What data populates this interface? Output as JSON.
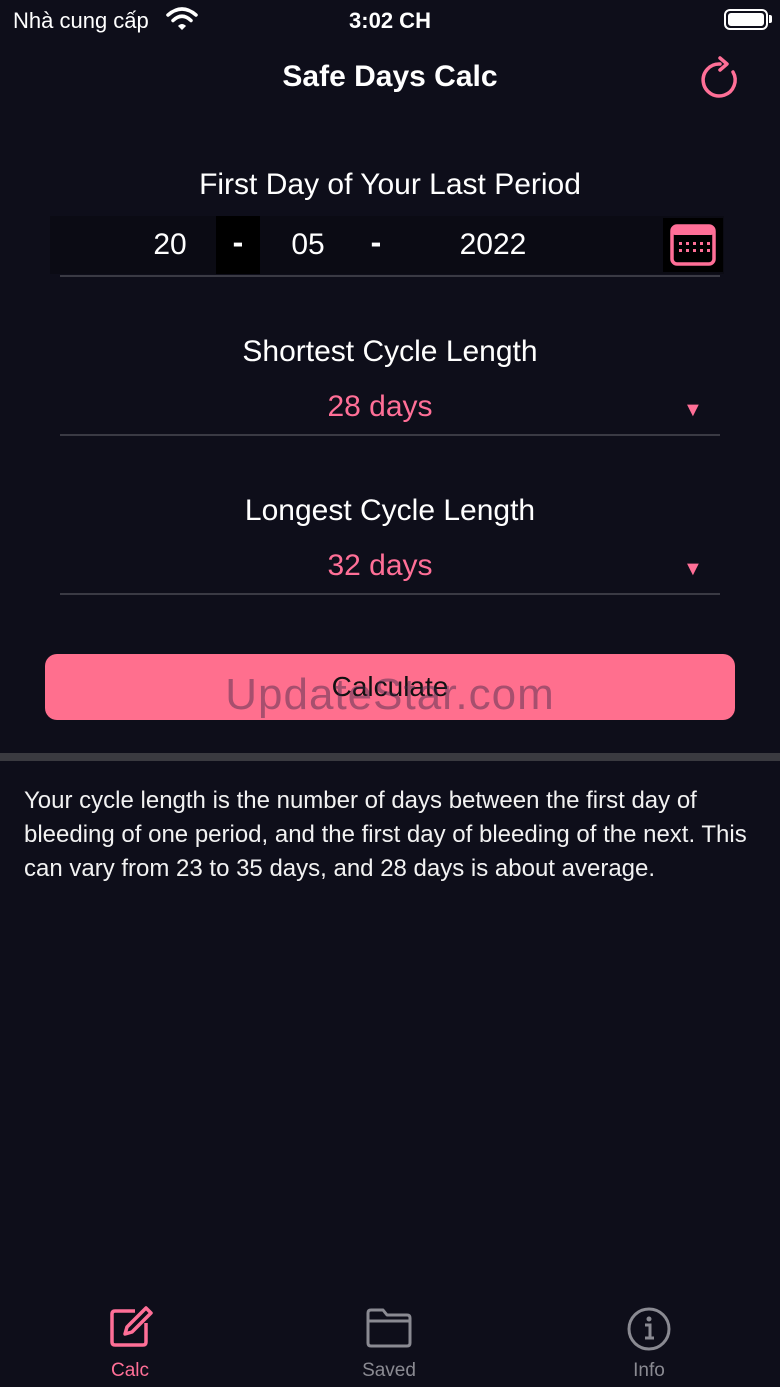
{
  "status_bar": {
    "carrier": "Nhà cung cấp",
    "time": "3:02 CH"
  },
  "nav": {
    "title": "Safe Days Calc",
    "refresh_icon": "refresh-icon"
  },
  "first_day": {
    "label": "First Day of Your Last Period",
    "day": "20",
    "separator1": "-",
    "month": "05",
    "separator2": "-",
    "year": "2022",
    "calendar_icon": "calendar-icon"
  },
  "shortest_cycle": {
    "label": "Shortest Cycle Length",
    "value": "28 days",
    "caret": "▼"
  },
  "longest_cycle": {
    "label": "Longest Cycle Length",
    "value": "32 days",
    "caret": "▼"
  },
  "calculate_label": "Calculate",
  "watermark": "UpdateStar.com",
  "info_text": "Your cycle length is the number of days between the first day of bleeding of one period, and the first day of bleeding of the next. This can vary from 23 to 35 days, and 28 days is about average.",
  "tabs": [
    {
      "label": "Calc",
      "icon": "edit-icon",
      "active": true
    },
    {
      "label": "Saved",
      "icon": "folder-icon",
      "active": false
    },
    {
      "label": "Info",
      "icon": "info-icon",
      "active": false
    }
  ],
  "colors": {
    "accent": "#ff6f97",
    "button": "#ff6f8e",
    "background": "#0e0e1a"
  }
}
